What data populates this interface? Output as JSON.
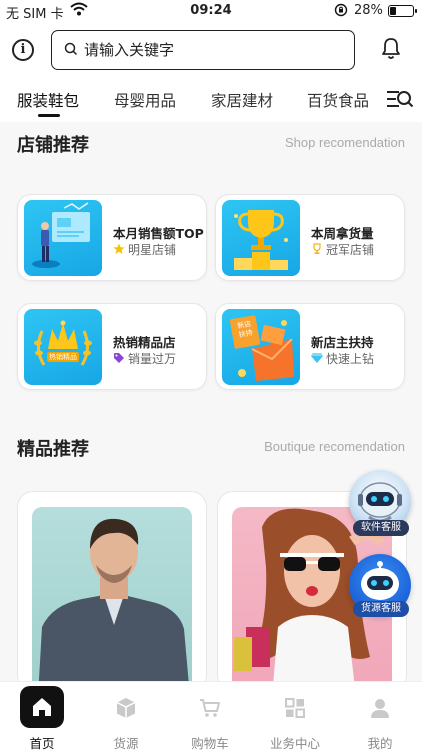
{
  "status_bar": {
    "carrier": "无 SIM 卡",
    "time": "09:24",
    "battery": "28%",
    "battery_level": 0.28
  },
  "search": {
    "placeholder": "请输入关键字"
  },
  "categories": [
    "服装鞋包",
    "母婴用品",
    "家居建材",
    "百货食品"
  ],
  "active_category": 0,
  "shop_section": {
    "title": "店铺推荐",
    "subtitle": "Shop recomendation"
  },
  "shops": [
    {
      "title": "本月销售额TOP",
      "badge": "明星店铺",
      "badge_icon": "star-icon",
      "badge_color": "#f5c400"
    },
    {
      "title": "本周拿货量",
      "badge": "冠军店铺",
      "badge_icon": "trophy-icon",
      "badge_color": "#f2b31b"
    },
    {
      "title": "热销精品店",
      "badge": "销量过万",
      "badge_icon": "tag-icon",
      "badge_color": "#8a47d6"
    },
    {
      "title": "新店主扶持",
      "badge": "快速上钻",
      "badge_icon": "diamond-icon",
      "badge_color": "#3cc4ee"
    }
  ],
  "thumb_texts": {
    "hot_shop_banner": "热销精品",
    "new_shop_sign": "新店扶持"
  },
  "boutique_section": {
    "title": "精品推荐",
    "subtitle": "Boutique recomendation"
  },
  "customer_service": [
    {
      "label": "软件客服"
    },
    {
      "label": "货源客服"
    }
  ],
  "tabs": [
    {
      "label": "首页",
      "icon": "home-icon",
      "active": true
    },
    {
      "label": "货源",
      "icon": "box-icon",
      "active": false
    },
    {
      "label": "购物车",
      "icon": "cart-icon",
      "active": false
    },
    {
      "label": "业务中心",
      "icon": "grid-icon",
      "active": false
    },
    {
      "label": "我的",
      "icon": "user-icon",
      "active": false
    }
  ],
  "colors": {
    "accent": "#111111",
    "thumb_bg": "#1fb4ef",
    "muted": "#aaaaaa"
  }
}
